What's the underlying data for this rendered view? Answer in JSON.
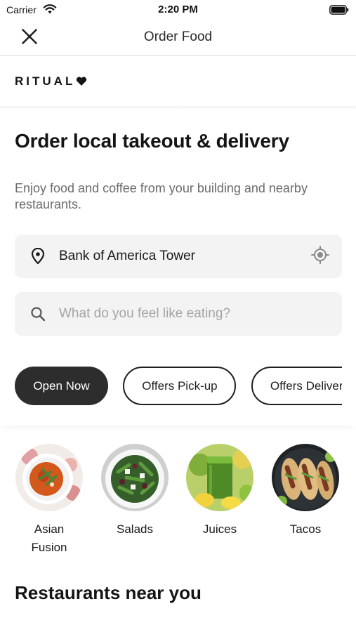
{
  "status_bar": {
    "carrier": "Carrier",
    "time": "2:20 PM",
    "icons": [
      "wifi-icon",
      "battery-icon"
    ]
  },
  "nav": {
    "title": "Order Food",
    "close_icon": "close-icon"
  },
  "brand": {
    "logo_text": "RITUAL",
    "logo_icon": "heart-icon"
  },
  "hero": {
    "headline": "Order local takeout & delivery",
    "subtext": "Enjoy food and coffee from your building and nearby restaurants."
  },
  "location_field": {
    "icon": "map-pin-icon",
    "value": "Bank of America Tower",
    "action_icon": "locate-me-icon"
  },
  "search_field": {
    "icon": "search-icon",
    "value": "",
    "placeholder": "What do you feel like eating?"
  },
  "filters": [
    {
      "label": "Open Now",
      "active": true
    },
    {
      "label": "Offers Pick-up",
      "active": false
    },
    {
      "label": "Offers Delivery",
      "active": false
    }
  ],
  "categories": [
    {
      "label": "Asian Fusion",
      "image": "asian-fusion-dish-image"
    },
    {
      "label": "Salads",
      "image": "salad-bowl-image"
    },
    {
      "label": "Juices",
      "image": "green-juice-image"
    },
    {
      "label": "Tacos",
      "image": "tacos-plate-image"
    }
  ],
  "sections": {
    "nearby_title": "Restaurants near you"
  },
  "colors": {
    "active_chip": "#2d2d2d",
    "field_background": "#f3f3f3",
    "muted_text": "#6b6b6b",
    "placeholder_text": "#a5a5a5"
  }
}
